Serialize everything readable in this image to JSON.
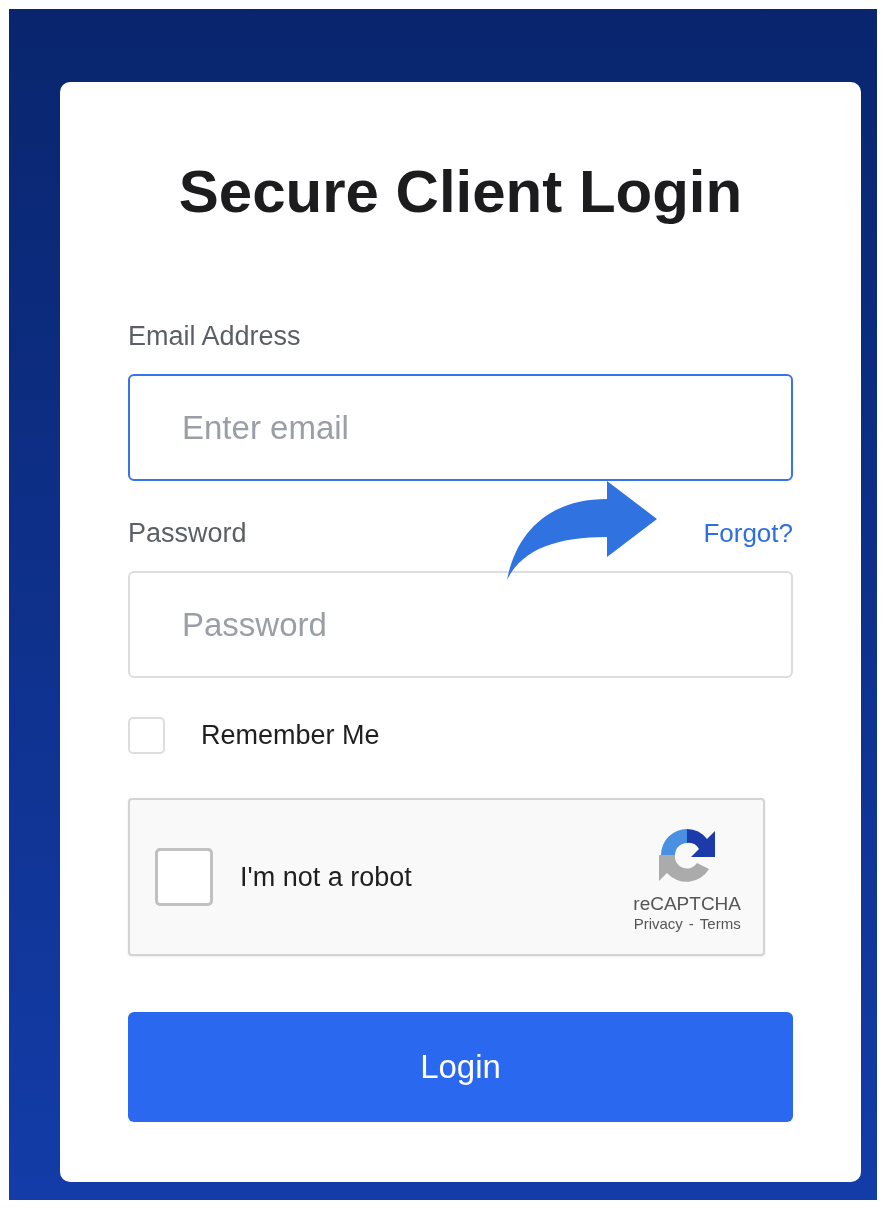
{
  "title": "Secure Client Login",
  "email": {
    "label": "Email Address",
    "placeholder": "Enter email",
    "focused": true
  },
  "password": {
    "label": "Password",
    "placeholder": "Password",
    "focused": false,
    "link": "Forgot?"
  },
  "remember": {
    "label": "Remember Me",
    "checked": false
  },
  "captcha": {
    "label": "I'm not a robot",
    "checked": false,
    "brand": "reCAPTCHA",
    "privacy": "Privacy",
    "separator": "-",
    "terms": "Terms"
  },
  "submit": {
    "label": "Login"
  }
}
